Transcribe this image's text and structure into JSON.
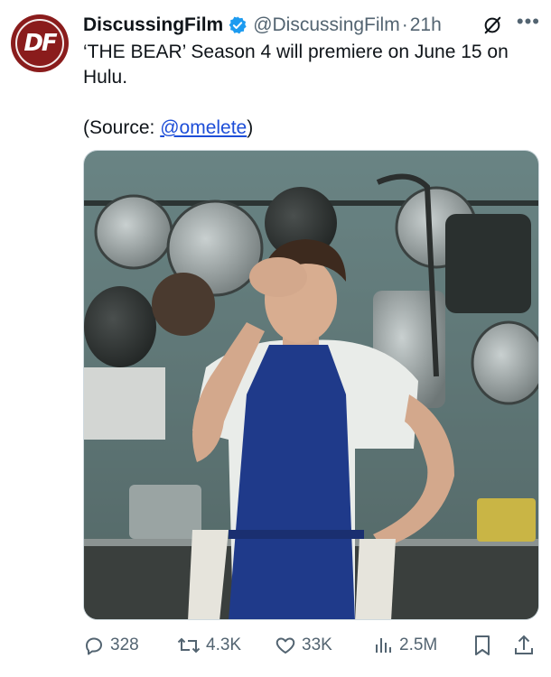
{
  "tweet": {
    "author_name": "DiscussingFilm",
    "author_handle": "@DiscussingFilm",
    "time_separator": "·",
    "time": "21h",
    "avatar_text": "DF",
    "text_line": "‘THE BEAR’ Season 4 will premiere on June 15 on Hulu.",
    "source_prefix": "(Source: ",
    "source_link": "@omelete",
    "source_suffix": ")"
  },
  "actions": {
    "replies": "328",
    "retweets": "4.3K",
    "likes": "33K",
    "views": "2.5M"
  },
  "icons": {
    "verified": "verified-badge-icon",
    "grok": "grok-icon",
    "more": "more-icon",
    "reply": "reply-icon",
    "retweet": "retweet-icon",
    "like": "heart-icon",
    "views": "views-icon",
    "bookmark": "bookmark-icon",
    "share": "share-icon"
  },
  "colors": {
    "text": "#0f1419",
    "secondary": "#536471",
    "link": "#1d4ed8",
    "verified": "#1d9bf0",
    "avatar": "#8a1c1c",
    "apron": "#1f3a8a"
  }
}
